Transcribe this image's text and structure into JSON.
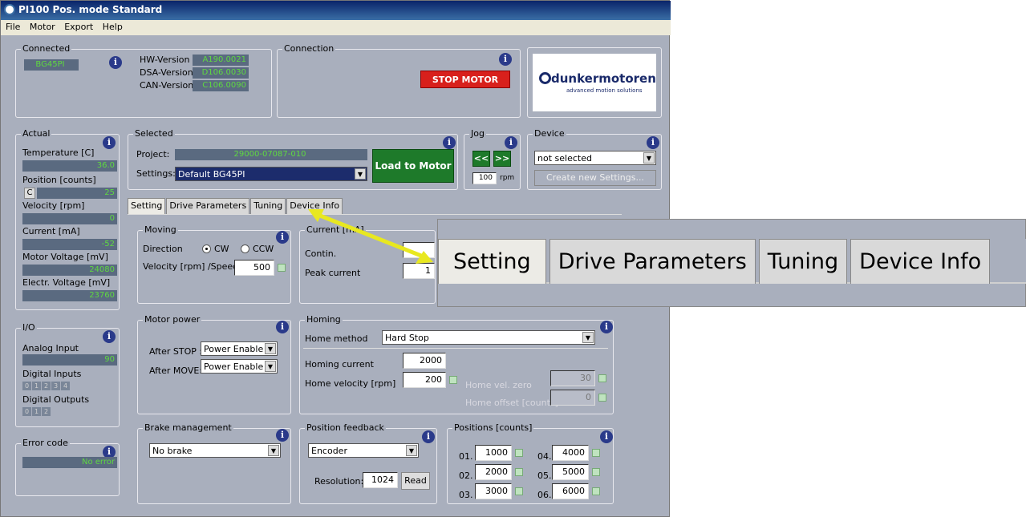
{
  "window": {
    "title": "PI100 Pos. mode Standard"
  },
  "menu": [
    "File",
    "Motor",
    "Export",
    "Help"
  ],
  "connected": {
    "title": "Connected",
    "device": "BG45PI",
    "hw_label": "HW-Version",
    "hw_value": "A190.0021",
    "dsa_label": "DSA-Version",
    "dsa_value": "D106.0030",
    "can_label": "CAN-Version",
    "can_value": "C106.0090"
  },
  "connection": {
    "title": "Connection",
    "stop": "STOP MOTOR"
  },
  "logo": {
    "name": "dunkermotoren",
    "tagline": "advanced motion solutions"
  },
  "actual": {
    "title": "Actual",
    "temp_label": "Temperature [C]",
    "temp": "36.0",
    "pos_label": "Position [counts]",
    "pos_btn": "C",
    "pos": "25",
    "vel_label": "Velocity [rpm]",
    "vel": "0",
    "cur_label": "Current [mA]",
    "cur": "-52",
    "mv_label": "Motor Voltage [mV]",
    "mv": "24080",
    "ev_label": "Electr. Voltage [mV]",
    "ev": "23760"
  },
  "selected": {
    "title": "Selected",
    "project_label": "Project:",
    "project": "29000-07087-010",
    "settings_label": "Settings:",
    "settings": "Default BG45PI",
    "load": "Load to Motor"
  },
  "jog": {
    "title": "Jog",
    "left": "<<",
    "right": ">>",
    "rpm_value": "100",
    "rpm_unit": "rpm"
  },
  "device": {
    "title": "Device",
    "select": "not selected",
    "create": "Create new Settings..."
  },
  "tabs": [
    "Setting",
    "Drive Parameters",
    "Tuning",
    "Device Info"
  ],
  "io": {
    "title": "I/O",
    "analog_label": "Analog Input",
    "analog": "90",
    "din_label": "Digital Inputs",
    "din": [
      "0",
      "1",
      "2",
      "3",
      "4"
    ],
    "dout_label": "Digital Outputs",
    "dout": [
      "0",
      "1",
      "2"
    ]
  },
  "error": {
    "title": "Error code",
    "value": "No error"
  },
  "moving": {
    "title": "Moving",
    "dir_label": "Direction",
    "cw": "CW",
    "ccw": "CCW",
    "vel_label": "Velocity [rpm] /Speed/",
    "vel": "500"
  },
  "current": {
    "title": "Current [mA]",
    "contin": "Contin.",
    "peak": "Peak current",
    "contin_val": "",
    "peak_val": "1"
  },
  "motor_power": {
    "title": "Motor power",
    "after_stop_label": "After STOP :",
    "after_stop": "Power Enable",
    "after_move_label": "After MOVE:",
    "after_move": "Power Enable"
  },
  "homing": {
    "title": "Homing",
    "method_label": "Home method",
    "method": "Hard Stop",
    "cur_label": "Homing current",
    "cur": "2000",
    "vel_label": "Home velocity [rpm]",
    "vel": "200",
    "velzero_label": "Home vel. zero",
    "velzero": "30",
    "offset_label": "Home offset [counts]",
    "offset": "0"
  },
  "brake": {
    "title": "Brake management",
    "value": "No brake"
  },
  "feedback": {
    "title": "Position feedback",
    "value": "Encoder",
    "res_label": "Resolution:",
    "res": "1024",
    "read": "Read"
  },
  "positions": {
    "title": "Positions [counts]",
    "items": [
      {
        "n": "01.",
        "v": "1000"
      },
      {
        "n": "02.",
        "v": "2000"
      },
      {
        "n": "03.",
        "v": "3000"
      },
      {
        "n": "04.",
        "v": "4000"
      },
      {
        "n": "05.",
        "v": "5000"
      },
      {
        "n": "06.",
        "v": "6000"
      }
    ]
  }
}
